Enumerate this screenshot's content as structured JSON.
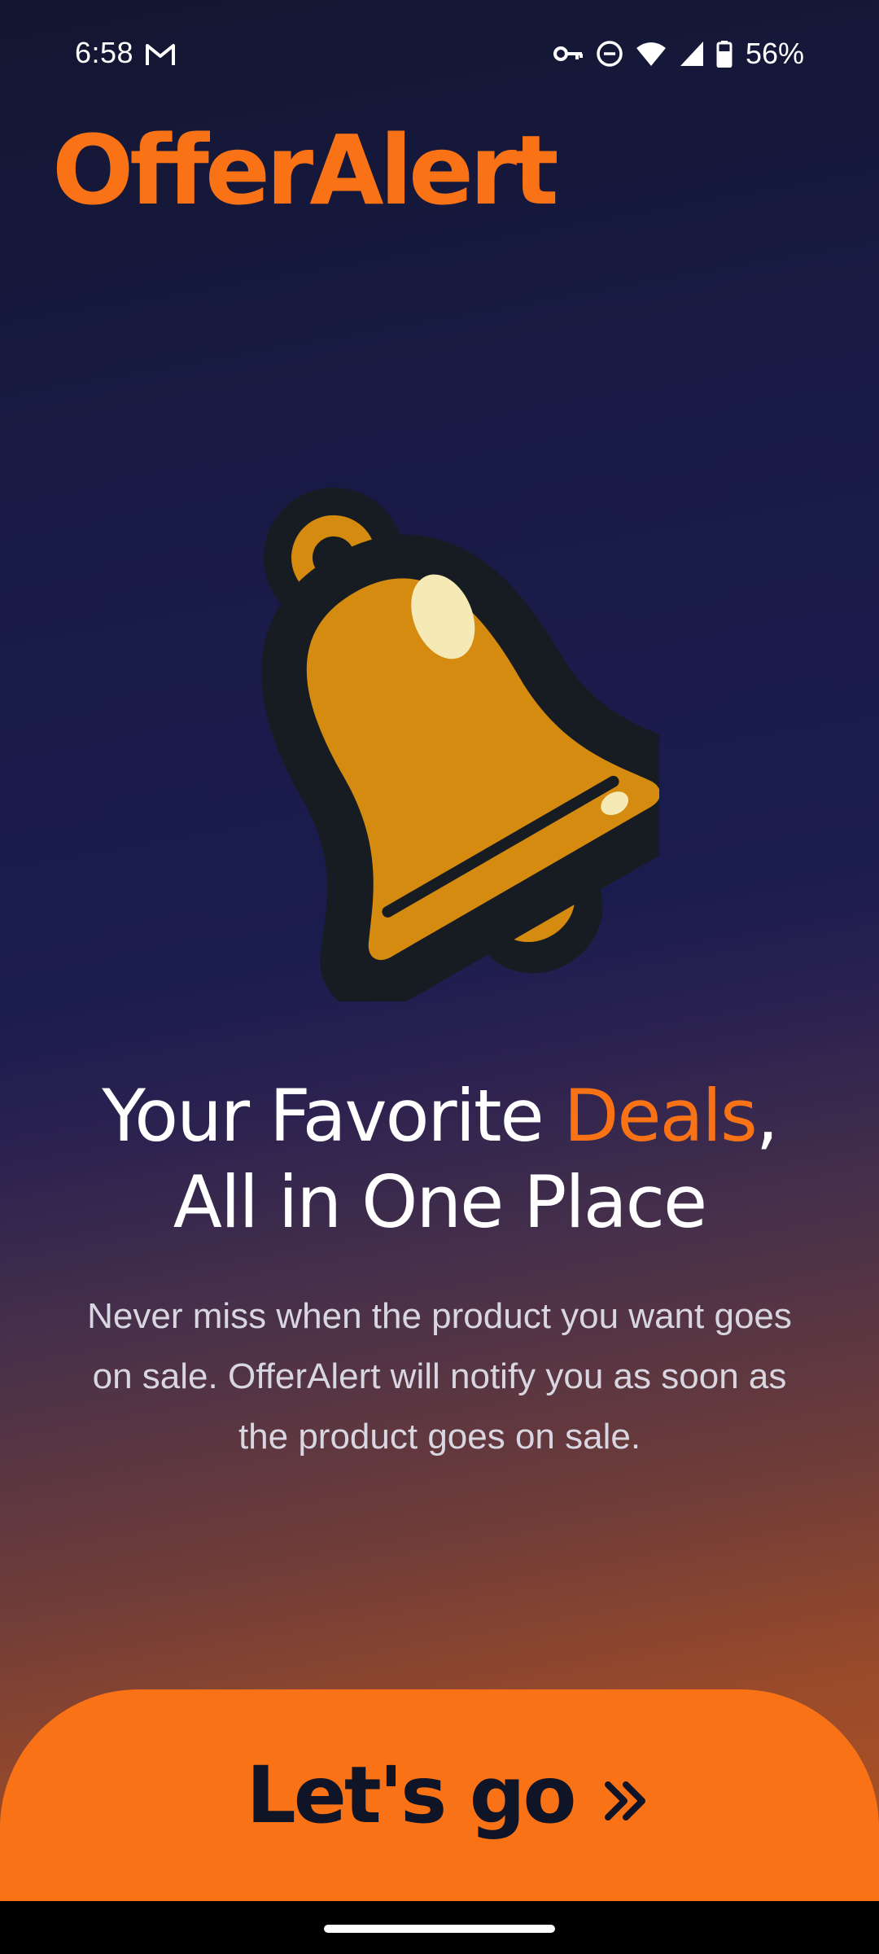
{
  "status_bar": {
    "time": "6:58",
    "battery": "56%",
    "icons": [
      "gmail-icon",
      "vpn-key-icon",
      "do-not-disturb-icon",
      "wifi-icon",
      "cellular-signal-icon",
      "battery-icon"
    ]
  },
  "app": {
    "name": "OfferAlert",
    "brand_color": "#f97316"
  },
  "hero": {
    "illustration": "bell-icon"
  },
  "headline": {
    "part1": "Your Favorite ",
    "accent": "Deals",
    "part2": ",",
    "line2": "All in One Place"
  },
  "subtitle": "Never miss when the product you want goes on sale. OfferAlert will notify you as soon as the product goes on sale.",
  "cta": {
    "label": "Let's go",
    "icon": "double-chevron-right-icon"
  }
}
